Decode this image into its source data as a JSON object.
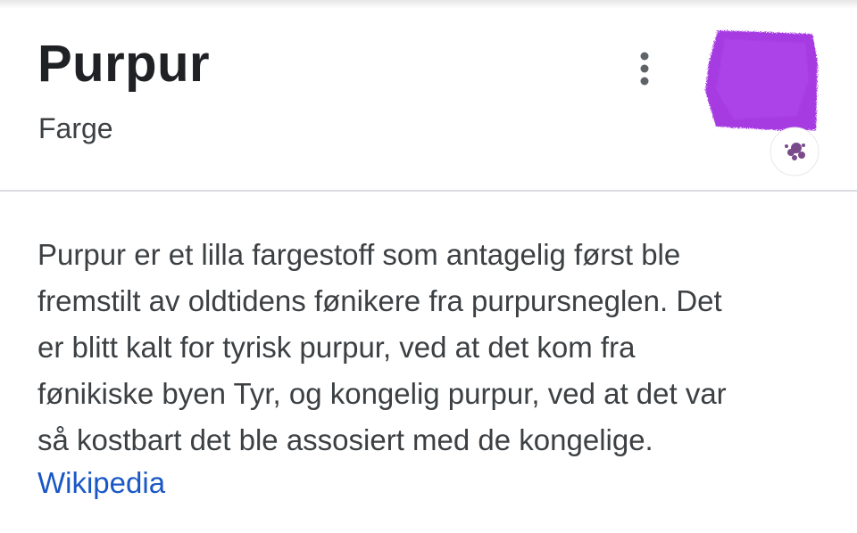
{
  "entity": {
    "title": "Purpur",
    "subtitle": "Farge",
    "more_icon": "more-vert-icon",
    "thumbnail_icon": "purple-pigment-thumbnail",
    "thumbnail_color": "#a63be2"
  },
  "description": {
    "lines": [
      "Purpur er et lilla fargestoff som antagelig først ble",
      "fremstilt av oldtidens fønikere fra purpursneglen. Det",
      "er blitt kalt for tyrisk purpur, ved at det kom fra",
      "fønikiske byen Tyr, og kongelig purpur, ved at det var",
      "så kostbart det ble assosiert med de kongelige."
    ],
    "source_label": "Wikipedia"
  },
  "colors": {
    "link": "#1a57c6",
    "divider": "#dadce0",
    "text": "#3c4043"
  }
}
